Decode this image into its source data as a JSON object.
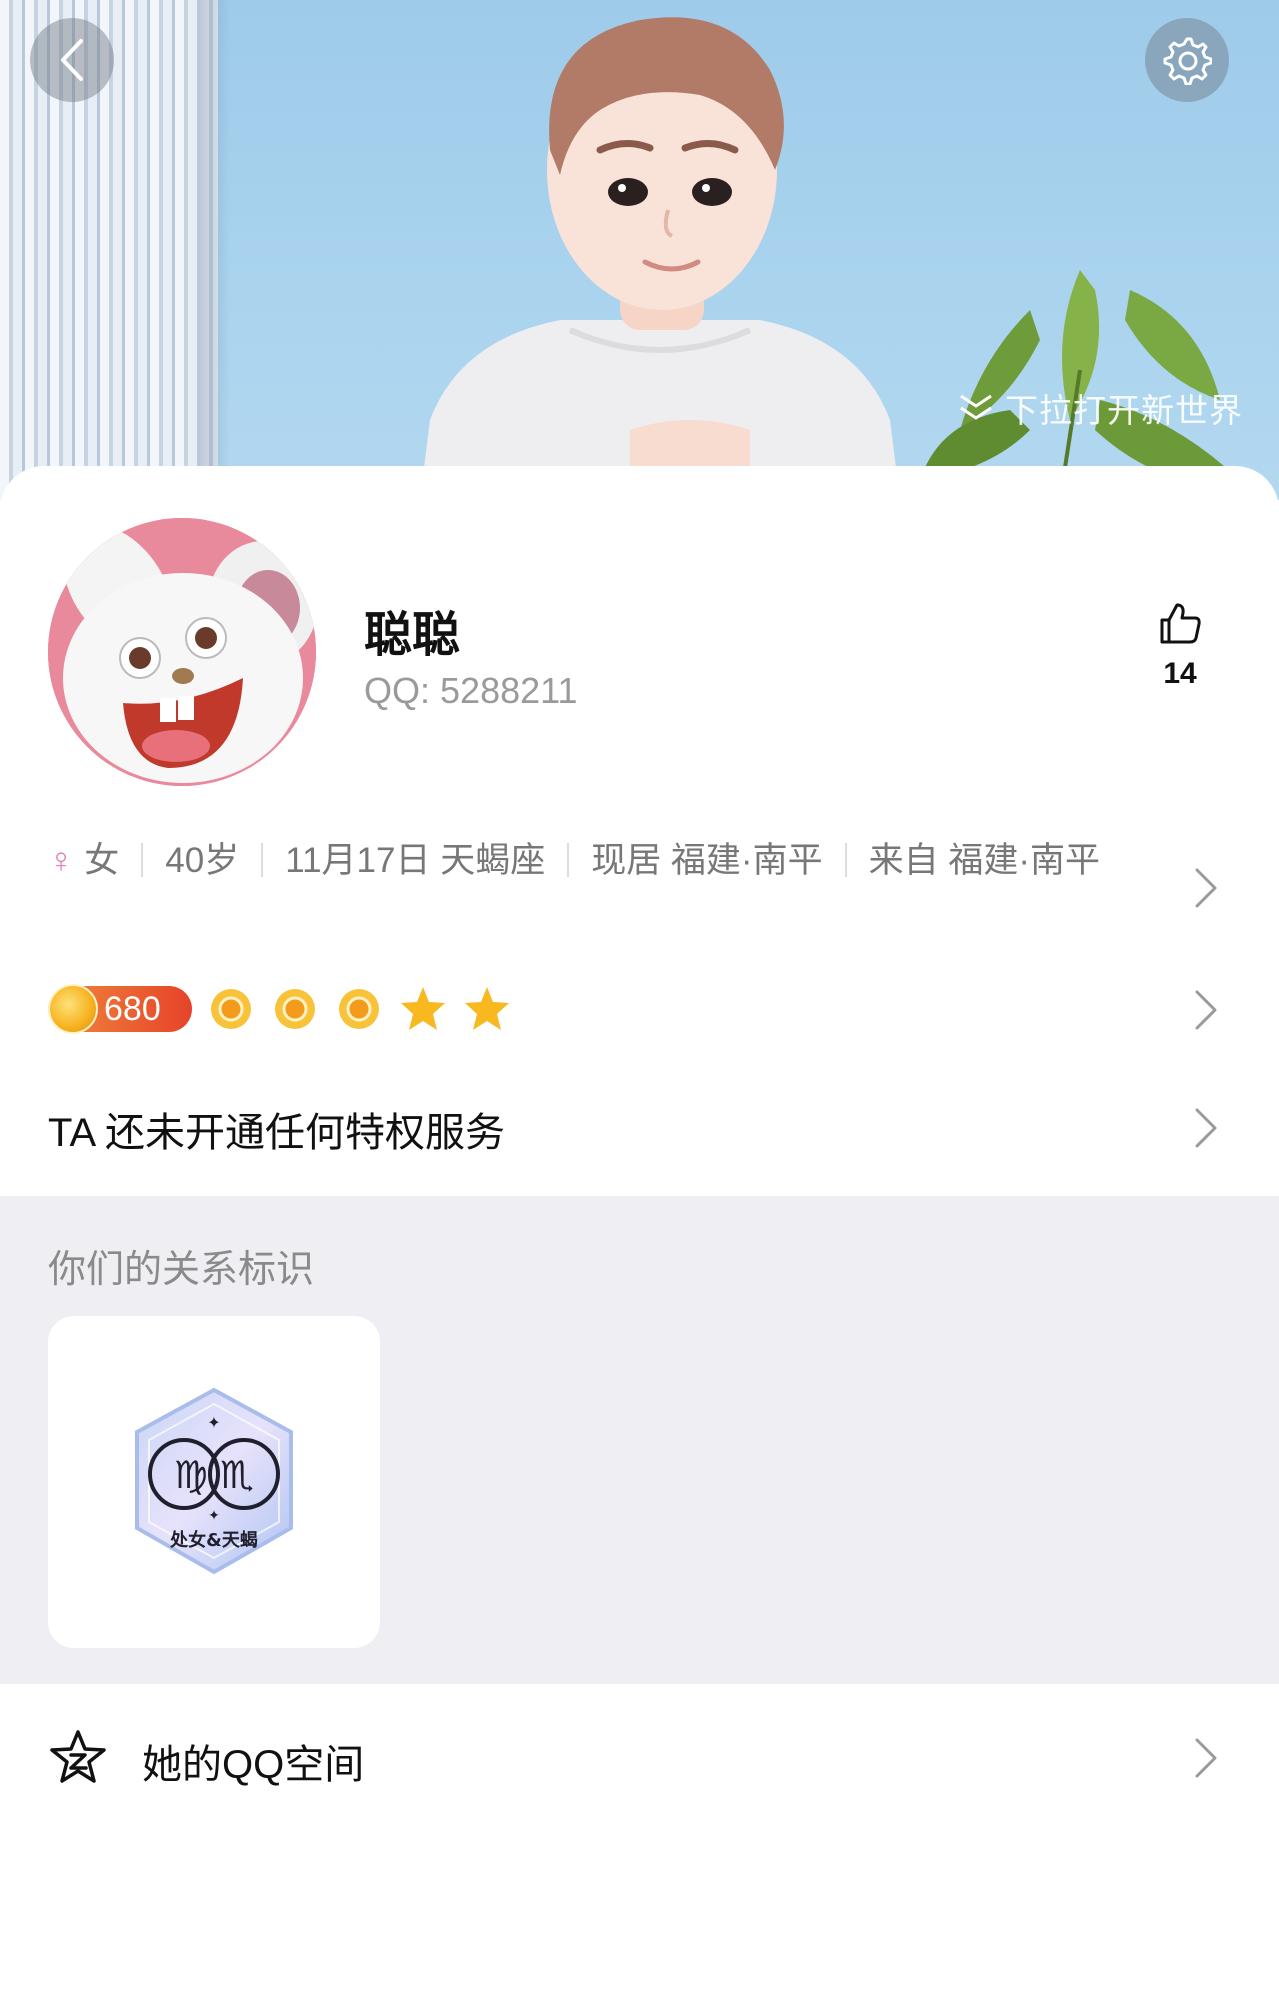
{
  "header": {
    "pull_hint": "下拉打开新世界"
  },
  "profile": {
    "nickname": "聪聪",
    "qq_label": "QQ:",
    "qq_number": "5288211",
    "like_count": "14"
  },
  "info": {
    "gender_symbol": "♀",
    "gender": "女",
    "age": "40岁",
    "birthday": "11月17日 天蝎座",
    "location": "现居 福建·南平",
    "hometown": "来自 福建·南平"
  },
  "level": {
    "points": "680",
    "icons": [
      "sun",
      "sun",
      "sun",
      "star",
      "star"
    ]
  },
  "privilege": {
    "text": "TA 还未开通任何特权服务"
  },
  "relation": {
    "title": "你们的关系标识",
    "badge_text": "处女&天蝎"
  },
  "qzone": {
    "label": "她的QQ空间"
  },
  "colors": {
    "accent_female": "#e57fb4",
    "coin_badge": "#e6432a",
    "level_gold": "#f6b11d",
    "section_gray": "#efeff3"
  }
}
